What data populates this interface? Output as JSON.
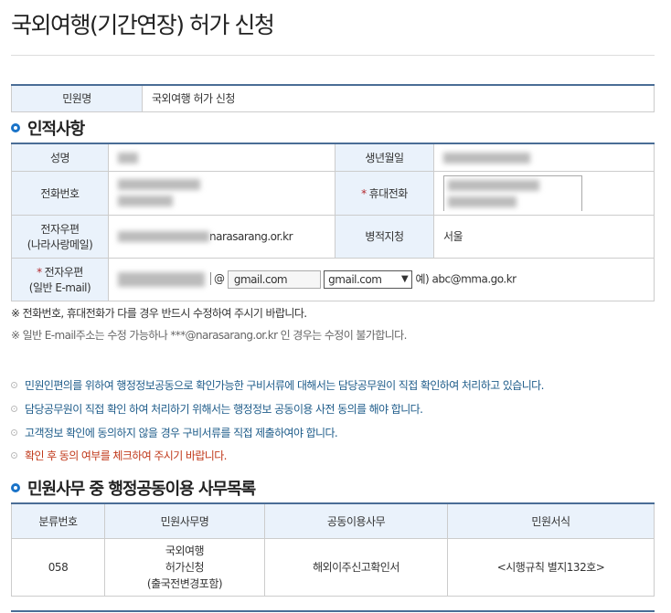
{
  "title": "국외여행(기간연장) 허가 신청",
  "application": {
    "label": "민원명",
    "value": "국외여행 허가 신청"
  },
  "personal": {
    "heading": "인적사항",
    "name_label": "성명",
    "birth_label": "생년월일",
    "phone_label": "전화번호",
    "mobile_label": "휴대전화",
    "email_label_1": "전자우편",
    "email_label_2": "(나라사랑메일)",
    "email_domain": "narasarang.or.kr",
    "office_label": "병적지청",
    "office_value": "서울",
    "general_email_label_1": "전자우편",
    "general_email_label_2": "(일반 E-mail)",
    "at": "@",
    "domain_input": "gmail.com",
    "domain_select": "gmail.com",
    "example": "예) abc@mma.go.kr",
    "required_mark": "*"
  },
  "notes": [
    "※ 전화번호, 휴대전화가 다를 경우 반드시 수정하여 주시기 바랍니다.",
    "※ 일반 E-mail주소는 수정 가능하나 ***@narasarang.or.kr 인 경우는 수정이 불가합니다."
  ],
  "bullets": [
    "민원인편의를 위하여 행정정보공동으로 확인가능한 구비서류에 대해서는 담당공무원이 직접 확인하여 처리하고 있습니다.",
    "담당공무원이 직접 확인 하여 처리하기 위해서는 행정정보 공동이용 사전 동의를 해야 합니다.",
    "고객정보 확인에 동의하지 않을 경우 구비서류를 직접 제출하여야 합니다.",
    "확인 후 동의 여부를 체크하여 주시기 바랍니다."
  ],
  "shared": {
    "heading": "민원사무 중 행정공동이용 사무목록",
    "headers": [
      "분류번호",
      "민원사무명",
      "공동이용사무",
      "민원서식"
    ],
    "row": {
      "code": "058",
      "name_lines": [
        "국외여행",
        "허가신청",
        "(출국전변경포함)"
      ],
      "service": "해외이주신고확인서",
      "form": "<시행규칙 별지132호>"
    }
  }
}
